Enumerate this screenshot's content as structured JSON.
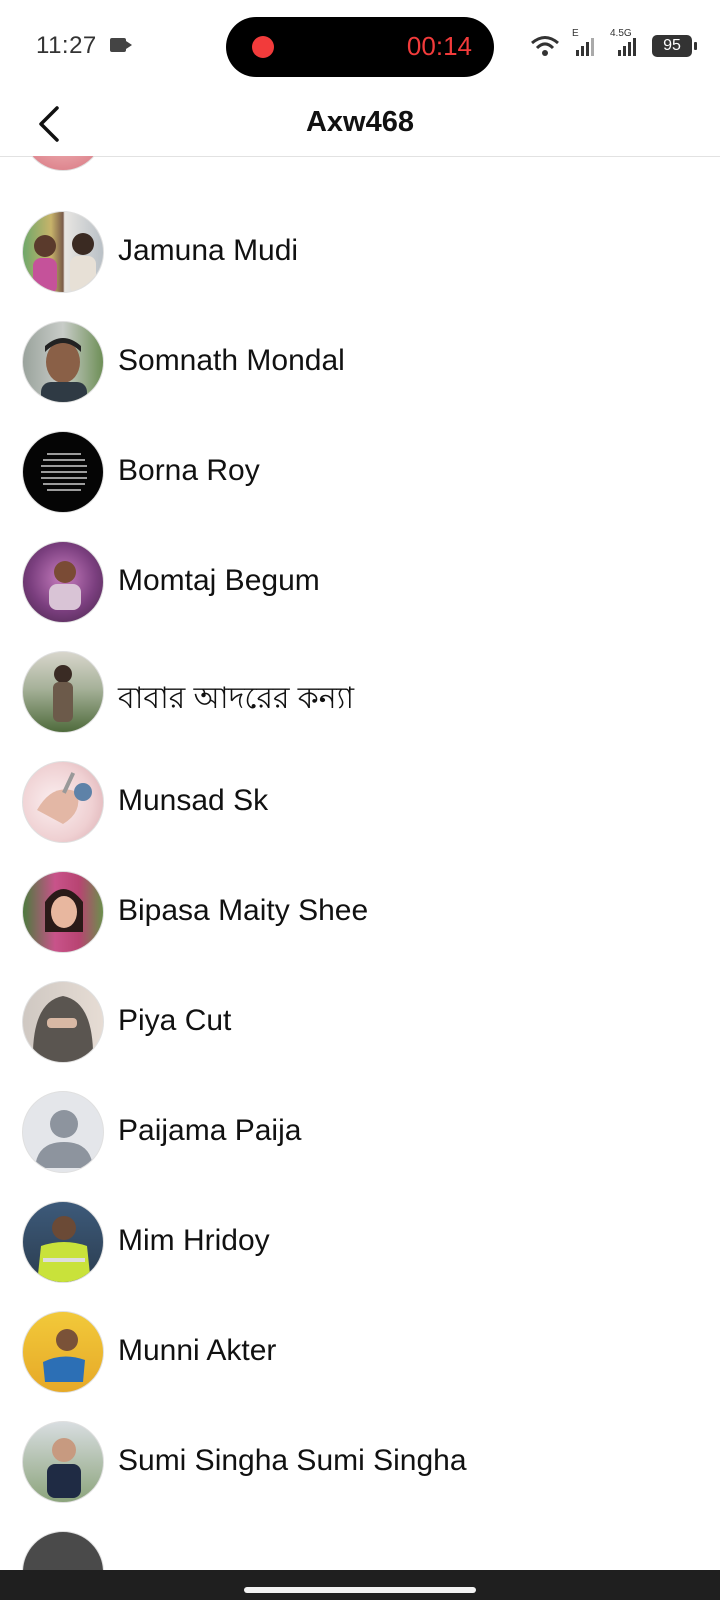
{
  "status_bar": {
    "time": "11:27",
    "recording_timer": "00:14",
    "network_1": "E",
    "network_2": "4.5G",
    "battery": "95"
  },
  "header": {
    "title": "Axw468"
  },
  "contacts": [
    {
      "name": "Jamuna Mudi"
    },
    {
      "name": "Somnath Mondal"
    },
    {
      "name": "Borna Roy"
    },
    {
      "name": "Momtaj Begum"
    },
    {
      "name": "বাবার আদরের কন্যা"
    },
    {
      "name": "Munsad Sk"
    },
    {
      "name": "Bipasa Maity Shee"
    },
    {
      "name": "Piya Cut"
    },
    {
      "name": "Paijama Paija"
    },
    {
      "name": "Mim Hridoy"
    },
    {
      "name": "Munni Akter"
    },
    {
      "name": "Sumi Singha Sumi Singha"
    }
  ],
  "icons": {
    "back": "chevron-left-icon",
    "recording": "record-dot-icon",
    "camera": "video-camera-icon",
    "wifi": "wifi-icon",
    "signal": "signal-icon",
    "battery": "battery-icon"
  },
  "colors": {
    "recording_red": "#f23b3b",
    "text": "#111111",
    "divider": "#e2e2e2",
    "nav_bar": "#1f1f1f"
  }
}
